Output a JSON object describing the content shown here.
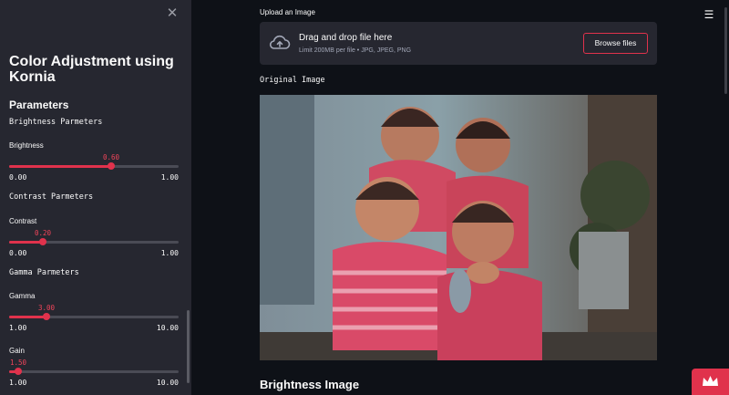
{
  "sidebar": {
    "title": "Color Adjustment using Kornia",
    "parameters_heading": "Parameters",
    "brightness": {
      "section": "Brightness Parmeters",
      "label": "Brightness",
      "value": "0.60",
      "min": "0.00",
      "max": "1.00",
      "fraction": 0.6
    },
    "contrast": {
      "section": "Contrast Parmeters",
      "label": "Contrast",
      "value": "0.20",
      "min": "0.00",
      "max": "1.00",
      "fraction": 0.2
    },
    "gamma": {
      "section": "Gamma Parmeters",
      "label": "Gamma",
      "value": "3.00",
      "min": "1.00",
      "max": "10.00",
      "fraction": 0.222
    },
    "gain": {
      "label": "Gain",
      "value": "1.50",
      "min": "1.00",
      "max": "10.00",
      "fraction": 0.056
    }
  },
  "main": {
    "upload_label": "Upload an Image",
    "dropzone_main": "Drag and drop file here",
    "dropzone_sub": "Limit 200MB per file • JPG, JPEG, PNG",
    "browse_label": "Browse files",
    "original_label": "Original Image",
    "brightness_heading": "Brightness Image"
  },
  "icons": {
    "close": "close-icon",
    "menu": "hamburger-menu-icon",
    "upload": "cloud-upload-icon",
    "crown": "crown-icon"
  },
  "colors": {
    "accent": "#e0324c",
    "sidebar_bg": "#262730",
    "main_bg": "#0e1117"
  }
}
